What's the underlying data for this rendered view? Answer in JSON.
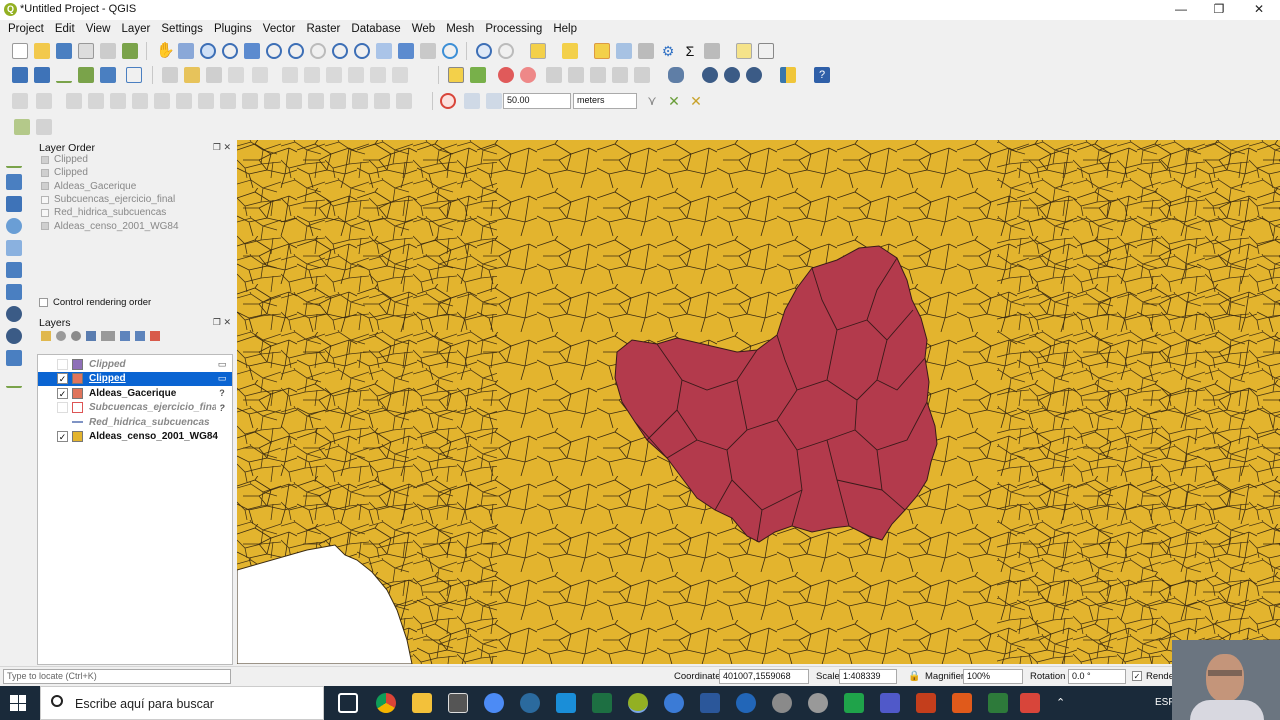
{
  "app": {
    "title": "*Untitled Project - QGIS",
    "logo_letter": "Q"
  },
  "menu": [
    "Project",
    "Edit",
    "View",
    "Layer",
    "Settings",
    "Plugins",
    "Vector",
    "Raster",
    "Database",
    "Web",
    "Mesh",
    "Processing",
    "Help"
  ],
  "digitize": {
    "tolerance_value": "50.00",
    "unit": "meters"
  },
  "layer_order": {
    "title": "Layer Order",
    "items": [
      {
        "label": "Clipped",
        "checked": true
      },
      {
        "label": "Clipped",
        "checked": true
      },
      {
        "label": "Aldeas_Gacerique",
        "checked": true
      },
      {
        "label": "Subcuencas_ejercicio_final",
        "checked": false
      },
      {
        "label": "Red_hidrica_subcuencas",
        "checked": false
      },
      {
        "label": "Aldeas_censo_2001_WG84",
        "checked": true
      }
    ],
    "control_rendering_label": "Control rendering order"
  },
  "layers_panel": {
    "title": "Layers",
    "items": [
      {
        "label": "Clipped",
        "checked": false,
        "selected": false,
        "italic": true,
        "color": "#8e6fb8",
        "tag": "▭"
      },
      {
        "label": "Clipped",
        "checked": true,
        "selected": true,
        "italic": false,
        "color": "#e0745b",
        "tag": "▭"
      },
      {
        "label": "Aldeas_Gacerique",
        "checked": true,
        "selected": false,
        "italic": false,
        "color": "#e0745b",
        "tag": "?"
      },
      {
        "label": "Subcuencas_ejercicio_final",
        "checked": false,
        "selected": false,
        "italic": true,
        "color": "#ffffff",
        "tag": "?"
      },
      {
        "label": "Red_hidrica_subcuencas",
        "checked": false,
        "selected": false,
        "italic": true,
        "color": "line",
        "tag": ""
      },
      {
        "label": "Aldeas_censo_2001_WG84",
        "checked": true,
        "selected": false,
        "italic": false,
        "color": "#e3b42e",
        "tag": ""
      }
    ]
  },
  "map": {
    "background_color": "#e3b42e",
    "highlight_color": "#b33a4c"
  },
  "status": {
    "locate_placeholder": "Type to locate (Ctrl+K)",
    "coordinate_label": "Coordinate",
    "coordinate_value": "401007,1559068",
    "scale_label": "Scale",
    "scale_value": "1:408339",
    "magnifier_label": "Magnifier",
    "magnifier_value": "100%",
    "rotation_label": "Rotation",
    "rotation_value": "0.0 °",
    "render_label": "Render"
  },
  "taskbar": {
    "search_placeholder": "Escribe aquí para buscar",
    "lang": "ESP"
  }
}
